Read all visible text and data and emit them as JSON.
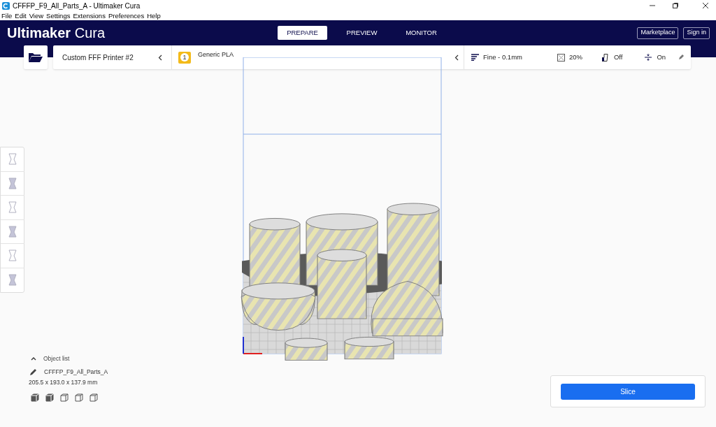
{
  "window": {
    "title": "CFFFP_F9_All_Parts_A - Ultimaker Cura"
  },
  "menu": [
    "File",
    "Edit",
    "View",
    "Settings",
    "Extensions",
    "Preferences",
    "Help"
  ],
  "header": {
    "logo_bold": "Ultimaker",
    "logo_light": "Cura",
    "tabs": [
      {
        "label": "PREPARE",
        "selected": true
      },
      {
        "label": "PREVIEW",
        "selected": false
      },
      {
        "label": "MONITOR",
        "selected": false
      }
    ],
    "buttons": [
      "Marketplace",
      "Sign in"
    ]
  },
  "printer": {
    "name": "Custom FFF Printer #2"
  },
  "material": {
    "badge": "1",
    "name": "Generic PLA"
  },
  "print_settings": {
    "profile": "Fine - 0.1mm",
    "infill": "20%",
    "support": "Off",
    "adhesion": "On"
  },
  "object_list": {
    "label": "Object list",
    "object_name": "CFFFP_F9_All_Parts_A",
    "dimensions": "205.5 x 193.0 x 137.9 mm"
  },
  "slice_button": "Slice"
}
